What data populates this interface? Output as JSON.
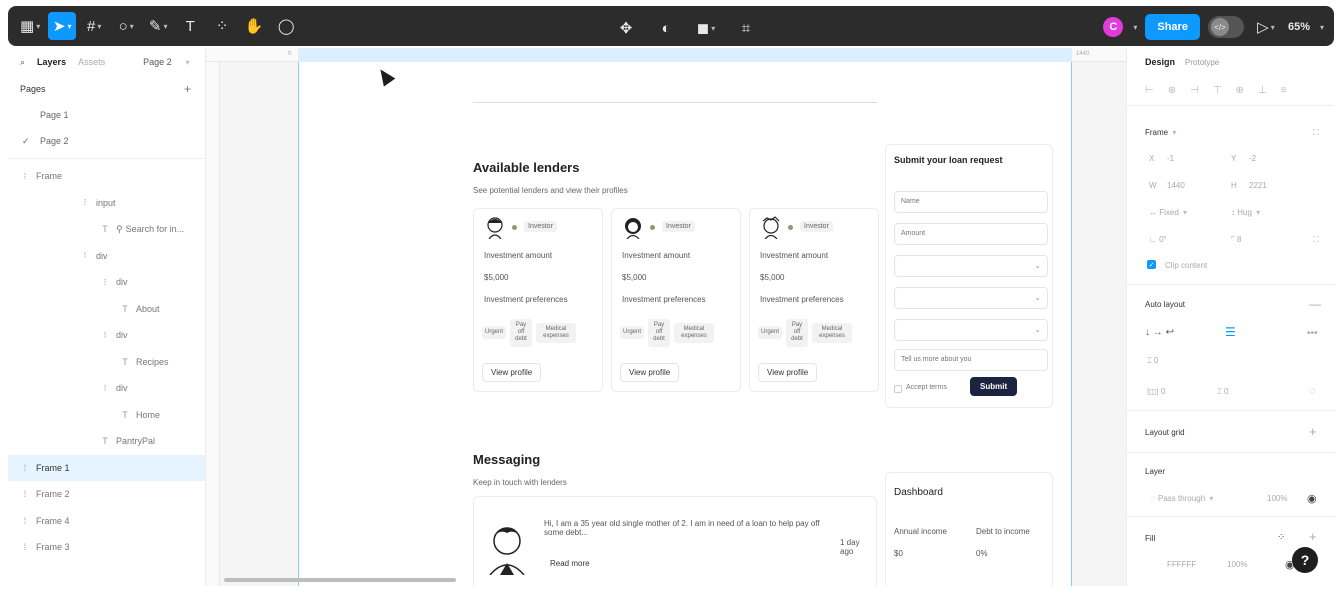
{
  "toolbar": {
    "zoom": "65%",
    "share_label": "Share",
    "avatar_initial": "C"
  },
  "left_panel": {
    "tab_layers": "Layers",
    "tab_assets": "Assets",
    "page_selector": "Page 2",
    "pages_heading": "Pages",
    "pages": [
      "Page 1",
      "Page 2"
    ],
    "layers": [
      {
        "label": "Frame",
        "icon": "frame"
      },
      {
        "label": "input",
        "icon": "grid"
      },
      {
        "label": "Search for in...",
        "icon": "text"
      },
      {
        "label": "div",
        "icon": "grid"
      },
      {
        "label": "div",
        "icon": "grid"
      },
      {
        "label": "About",
        "icon": "text"
      },
      {
        "label": "div",
        "icon": "grid"
      },
      {
        "label": "Recipes",
        "icon": "text"
      },
      {
        "label": "div",
        "icon": "grid"
      },
      {
        "label": "Home",
        "icon": "text"
      },
      {
        "label": "PantryPal",
        "icon": "text"
      },
      {
        "label": "Frame 1",
        "icon": "frame"
      },
      {
        "label": "Frame 2",
        "icon": "frame"
      },
      {
        "label": "Frame 4",
        "icon": "frame"
      },
      {
        "label": "Frame 3",
        "icon": "frame"
      }
    ]
  },
  "canvas": {
    "ruler_start": "0",
    "ruler_end": "1440",
    "lenders": {
      "title": "Available lenders",
      "subtitle": "See potential lenders and view their profiles",
      "cards": [
        {
          "badge": "Investor",
          "amount_label": "Investment amount",
          "amount": "$5,000",
          "prefs_label": "Investment preferences",
          "tags": [
            "Urgent",
            "Pay off debt",
            "Medical expenses"
          ],
          "button": "View profile"
        },
        {
          "badge": "Investor",
          "amount_label": "Investment amount",
          "amount": "$5,000",
          "prefs_label": "Investment preferences",
          "tags": [
            "Urgent",
            "Pay off debt",
            "Medical expenses"
          ],
          "button": "View profile"
        },
        {
          "badge": "Investor",
          "amount_label": "Investment amount",
          "amount": "$5,000",
          "prefs_label": "Investment preferences",
          "tags": [
            "Urgent",
            "Pay off debt",
            "Medical expenses"
          ],
          "button": "View profile"
        }
      ]
    },
    "loan_form": {
      "title": "Submit your loan request",
      "name_placeholder": "Name",
      "amount_placeholder": "Amount",
      "message_placeholder": "Tell us more about you",
      "accept_terms": "Accept terms",
      "submit": "Submit"
    },
    "messaging": {
      "title": "Messaging",
      "subtitle": "Keep in touch with lenders",
      "message": "Hi, I am a 35 year old single mother of 2. I am in need of a loan to help pay off some debt...",
      "time": "1 day ago",
      "read_more": "Read more"
    },
    "dashboard": {
      "title": "Dashboard",
      "annual_income_label": "Annual income",
      "annual_income": "$0",
      "debt_label": "Debt to income",
      "debt": "0%"
    }
  },
  "right_panel": {
    "tab_design": "Design",
    "tab_prototype": "Prototype",
    "frame_heading": "Frame",
    "x_label": "X",
    "x": "-1",
    "y_label": "Y",
    "y": "-2",
    "w_label": "W",
    "w": "1440",
    "h_label": "H",
    "h": "2221",
    "width_mode": "Fixed",
    "height_mode": "Hug",
    "rotation": "0°",
    "radius": "8",
    "clip_content": "Clip content",
    "auto_layout_heading": "Auto layout",
    "gap": "0",
    "padding_h": "0",
    "padding_v": "0",
    "layout_grid_heading": "Layout grid",
    "layer_heading": "Layer",
    "blend_mode": "Pass through",
    "layer_opacity": "100%",
    "fill_heading": "Fill",
    "fill_hex": "FFFFFF",
    "fill_opacity": "100%"
  }
}
